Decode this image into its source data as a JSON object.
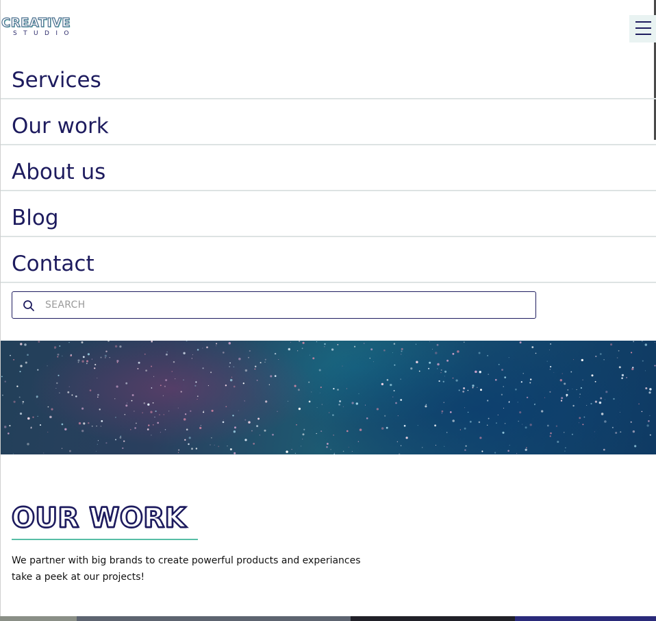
{
  "header": {
    "logo_top": "CREATIVE",
    "logo_bottom": "STUDIO"
  },
  "nav": {
    "items": [
      {
        "label": "Services"
      },
      {
        "label": "Our work"
      },
      {
        "label": "About us"
      },
      {
        "label": "Blog"
      },
      {
        "label": "Contact"
      }
    ]
  },
  "search": {
    "placeholder": "SEARCH",
    "value": ""
  },
  "our_work": {
    "title": "OUR WORK",
    "line1": "We partner with big brands to create powerful products and experiances",
    "line2": "take a peek at our projects!"
  },
  "colors": {
    "brand_navy": "#1d1b5e",
    "accent_teal": "#57bda6"
  },
  "icons": {
    "menu": "hamburger-menu-icon",
    "search": "search-icon"
  }
}
